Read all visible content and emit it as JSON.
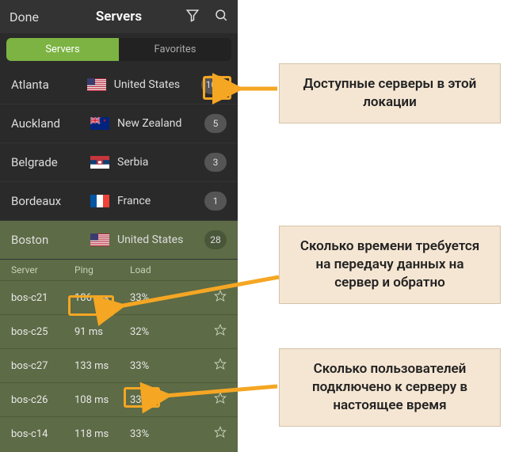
{
  "header": {
    "done_label": "Done",
    "title": "Servers"
  },
  "tabs": {
    "servers": "Servers",
    "favorites": "Favorites"
  },
  "locations": [
    {
      "city": "Atlanta",
      "country": "United States",
      "count": "100"
    },
    {
      "city": "Auckland",
      "country": "New Zealand",
      "count": "5"
    },
    {
      "city": "Belgrade",
      "country": "Serbia",
      "count": "3"
    },
    {
      "city": "Bordeaux",
      "country": "France",
      "count": "1"
    },
    {
      "city": "Boston",
      "country": "United States",
      "count": "28"
    }
  ],
  "server_headers": {
    "server": "Server",
    "ping": "Ping",
    "load": "Load"
  },
  "servers": [
    {
      "name": "bos-c21",
      "ping": "106 ms",
      "load": "33%"
    },
    {
      "name": "bos-c25",
      "ping": "91 ms",
      "load": "32%"
    },
    {
      "name": "bos-c27",
      "ping": "133 ms",
      "load": "33%"
    },
    {
      "name": "bos-c26",
      "ping": "108 ms",
      "load": "33%"
    },
    {
      "name": "bos-c14",
      "ping": "118 ms",
      "load": "33%"
    }
  ],
  "callouts": {
    "c1": "Доступные серверы в этой локации",
    "c2": "Сколько времени требуется на передачу данных на сервер и обратно",
    "c3": "Сколько пользователей подключено к серверу в настоящее время"
  }
}
